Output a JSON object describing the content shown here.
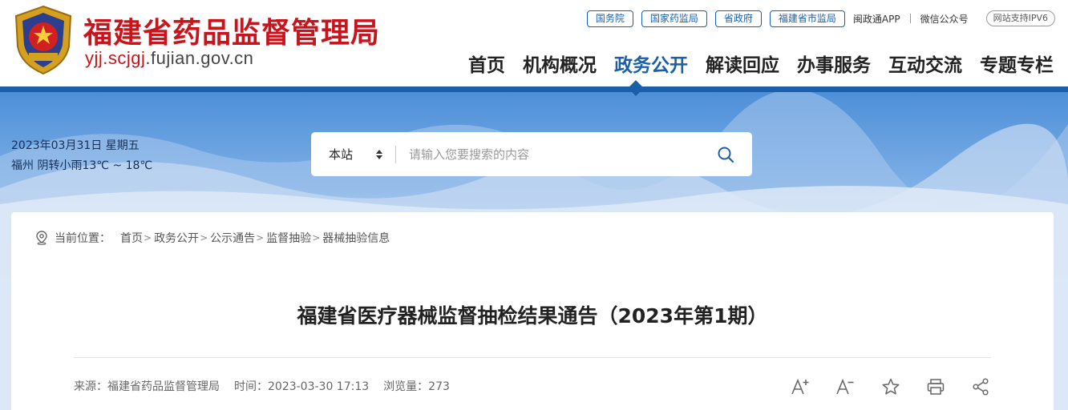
{
  "header": {
    "site_name": "福建省药品监督管理局",
    "domain_prefix": "yjj.scjgj",
    "domain_suffix": ".fujian.gov.cn",
    "top_links": [
      "国务院",
      "国家药监局",
      "省政府",
      "福建省市监局"
    ],
    "app_link": "闽政通APP",
    "wechat_link": "微信公众号",
    "ipv6_badge": "网站支持IPV6",
    "nav": [
      "首页",
      "机构概况",
      "政务公开",
      "解读回应",
      "办事服务",
      "互动交流",
      "专题专栏"
    ],
    "active_nav": "政务公开"
  },
  "info": {
    "date": "2023年03月31日  星期五",
    "weather": "福州  阴转小雨13℃ ~ 18℃"
  },
  "search": {
    "scope": "本站",
    "placeholder": "请输入您要搜索的内容"
  },
  "breadcrumb": {
    "label": "当前位置：",
    "items": [
      "首页",
      "政务公开",
      "公示通告",
      "监督抽验",
      "器械抽验信息"
    ]
  },
  "article": {
    "title": "福建省医疗器械监督抽检结果通告（2023年第1期）",
    "source": "来源：福建省药品监督管理局",
    "time": "时间：2023-03-30 17:13",
    "views": "浏览量：273"
  },
  "colors": {
    "brand_red": "#c8141c",
    "brand_blue": "#1a5fa8"
  },
  "icons": [
    "font-increase-icon",
    "font-decrease-icon",
    "star-icon",
    "print-icon",
    "share-icon",
    "search-icon",
    "location-pin-icon"
  ]
}
